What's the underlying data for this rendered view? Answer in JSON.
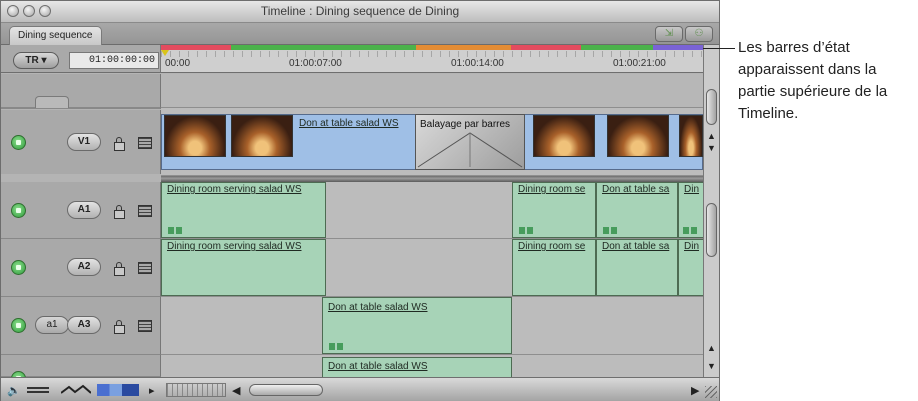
{
  "window": {
    "title": "Timeline : Dining sequence de Dining"
  },
  "tabs": [
    {
      "label": "Dining sequence"
    }
  ],
  "header": {
    "track_mode": "TR",
    "timecode": "01:00:00:00"
  },
  "ruler": {
    "labels": [
      "00:00",
      "01:00:07:00",
      "01:00:14:00",
      "01:00:21:00"
    ],
    "status_colors": [
      "#e34c5f",
      "#4bb24b",
      "#e38c34",
      "#e34c5f",
      "#4bb24b",
      "#7a63d6"
    ]
  },
  "tracks": {
    "v1": {
      "target": "V1",
      "clips": [
        {
          "label": "Don at table salad WS"
        },
        {
          "label": "Balayage par barres"
        }
      ]
    },
    "a1": {
      "target": "A1",
      "clips": [
        {
          "label": "Dining room serving salad WS"
        },
        {
          "label": "Dining room se"
        },
        {
          "label": "Don at table sa"
        },
        {
          "label": "Din"
        }
      ]
    },
    "a2": {
      "target": "A2",
      "clips": [
        {
          "label": "Dining room serving salad WS"
        },
        {
          "label": "Dining room se"
        },
        {
          "label": "Don at table sa"
        },
        {
          "label": "Din"
        }
      ]
    },
    "a3": {
      "source": "a1",
      "target": "A3",
      "clips": [
        {
          "label": "Don at table salad WS"
        }
      ]
    },
    "a4": {
      "clips": [
        {
          "label": "Don at table salad WS"
        }
      ]
    }
  },
  "callout": {
    "text": "Les barres d’état apparaissent dans la partie supérieure de la Timeline."
  }
}
